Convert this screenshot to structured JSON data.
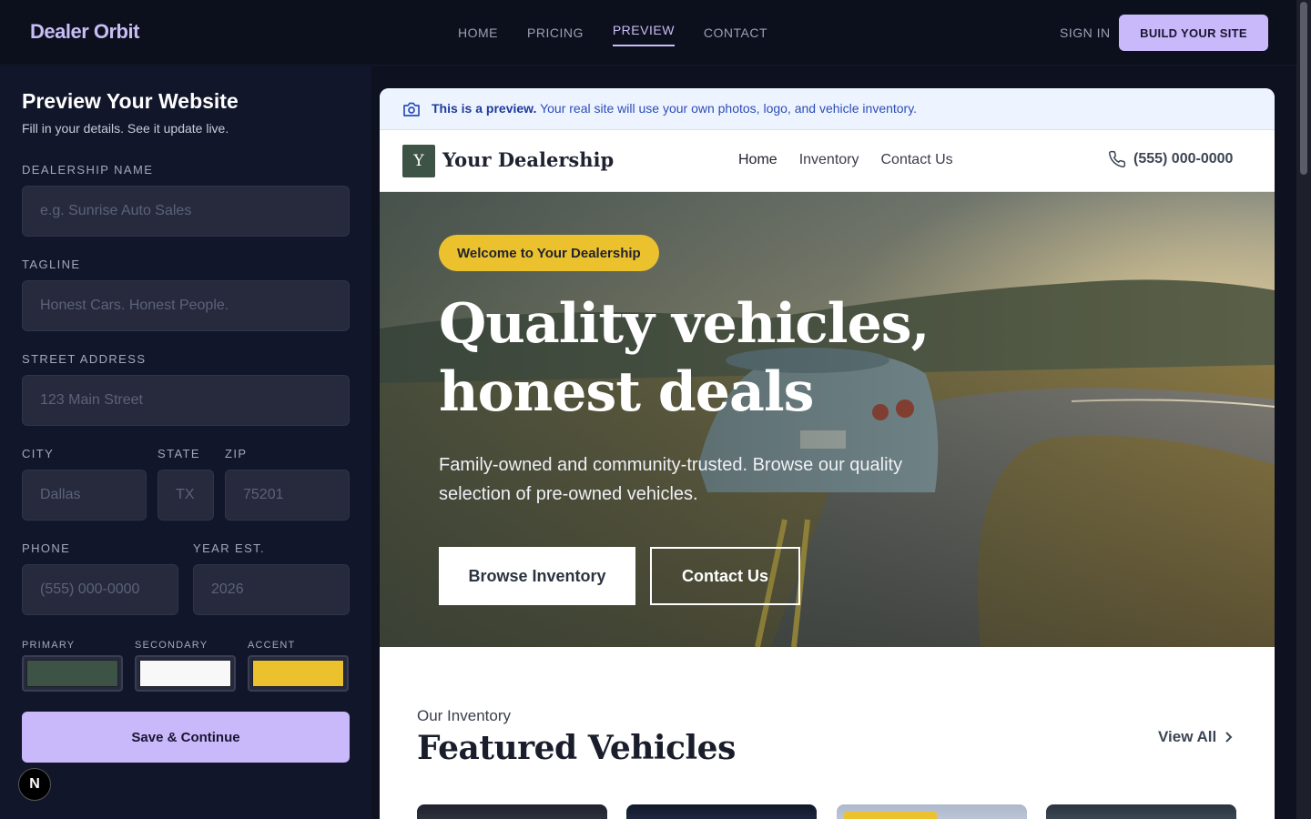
{
  "app": {
    "brand": "Dealer Orbit",
    "nav": [
      "HOME",
      "PRICING",
      "PREVIEW",
      "CONTACT"
    ],
    "nav_active": "PREVIEW",
    "sign_in": "SIGN IN",
    "cta": "BUILD YOUR SITE"
  },
  "form": {
    "title": "Preview Your Website",
    "subtitle": "Fill in your details. See it update live.",
    "dealership_name": {
      "label": "DEALERSHIP NAME",
      "placeholder": "e.g. Sunrise Auto Sales",
      "value": ""
    },
    "tagline": {
      "label": "TAGLINE",
      "placeholder": "Honest Cars. Honest People.",
      "value": ""
    },
    "street": {
      "label": "STREET ADDRESS",
      "placeholder": "123 Main Street",
      "value": ""
    },
    "city": {
      "label": "CITY",
      "placeholder": "Dallas",
      "value": ""
    },
    "state": {
      "label": "STATE",
      "placeholder": "TX",
      "value": ""
    },
    "zip": {
      "label": "ZIP",
      "placeholder": "75201",
      "value": ""
    },
    "phone": {
      "label": "PHONE",
      "placeholder": "(555) 000-0000",
      "value": ""
    },
    "year": {
      "label": "YEAR EST.",
      "placeholder": "2026",
      "value": ""
    },
    "colors": [
      {
        "label": "PRIMARY",
        "hex": "#3d5346"
      },
      {
        "label": "SECONDARY",
        "hex": "#f8f8f8"
      },
      {
        "label": "ACCENT",
        "hex": "#ecc12e"
      }
    ],
    "save": "Save & Continue",
    "badge": "N"
  },
  "preview": {
    "banner_bold": "This is a preview.",
    "banner_rest": "Your real site will use your own photos, logo, and vehicle inventory.",
    "site": {
      "logo_letter": "Y",
      "name": "Your Dealership",
      "nav": [
        "Home",
        "Inventory",
        "Contact Us"
      ],
      "phone": "(555) 000-0000"
    },
    "hero": {
      "pill": "Welcome to Your Dealership",
      "title": "Quality vehicles, honest deals",
      "subtitle": "Family-owned and community-trusted. Browse our quality selection of pre-owned vehicles.",
      "primary_btn": "Browse Inventory",
      "secondary_btn": "Contact Us"
    },
    "inventory": {
      "kicker": "Our Inventory",
      "title": "Featured Vehicles",
      "view_all": "View All"
    }
  },
  "icons": {
    "camera": "camera-icon",
    "phone": "phone-icon",
    "chevron": "chevron-right-icon"
  },
  "colors": {
    "accent": "#c9b9fb",
    "bg": "#0d1120",
    "sidebar": "#12162a",
    "hero_pill": "#ecc12e"
  }
}
